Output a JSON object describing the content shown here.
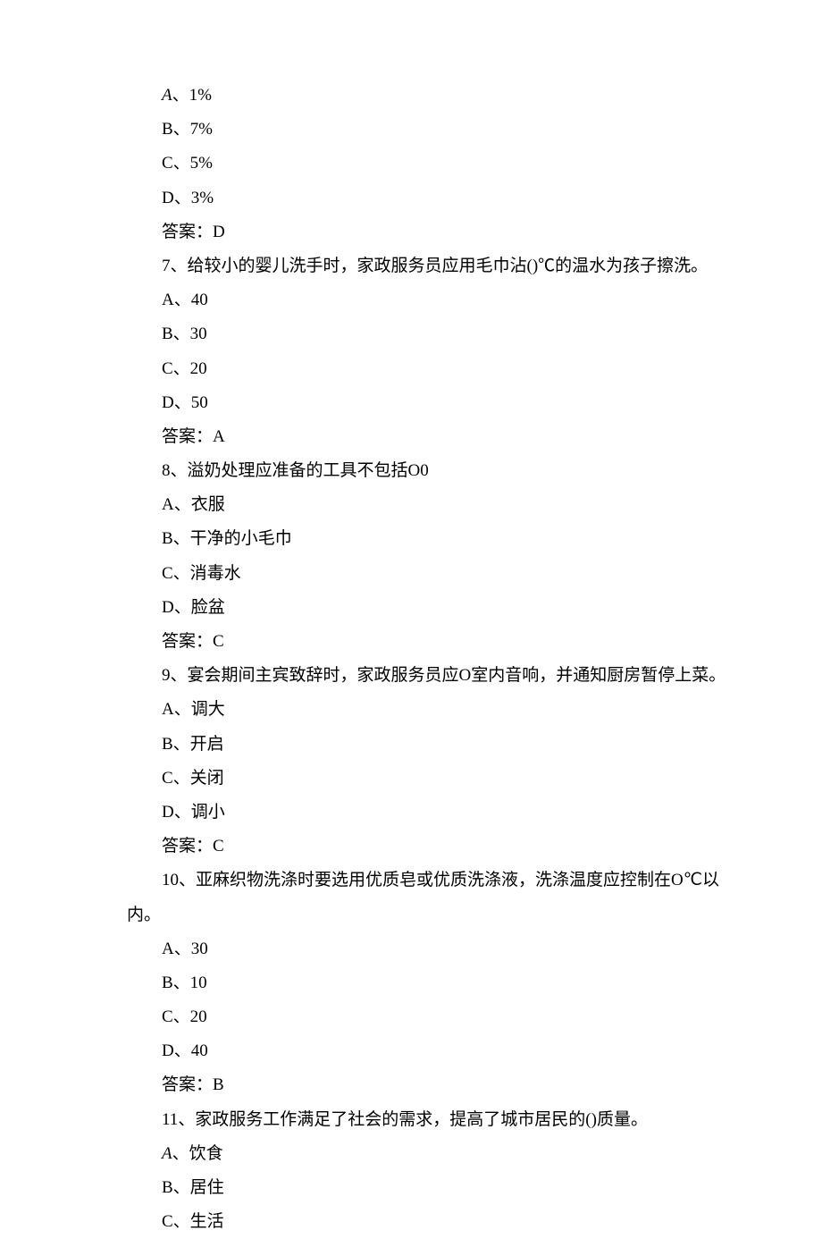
{
  "q6_tail": {
    "optA_letter": "A",
    "optA": "、1%",
    "optB": "B、7%",
    "optC": "C、5%",
    "optD": "D、3%",
    "ans": "答案：D"
  },
  "q7": {
    "stem": "7、给较小的婴儿洗手时，家政服务员应用毛巾沾()℃的温水为孩子擦洗。",
    "optA": "A、40",
    "optB": "B、30",
    "optC": "C、20",
    "optD": "D、50",
    "ans": "答案：A"
  },
  "q8": {
    "stem": "8、溢奶处理应准备的工具不包括O0",
    "optA": "A、衣服",
    "optB": "B、干净的小毛巾",
    "optC": "C、消毒水",
    "optD": "D、脸盆",
    "ans": "答案：C"
  },
  "q9": {
    "stem": "9、宴会期间主宾致辞时，家政服务员应O室内音响，并通知厨房暂停上菜。",
    "optA": "A、调大",
    "optB": "B、开启",
    "optC": "C、关闭",
    "optD": "D、调小",
    "ans": "答案：C"
  },
  "q10": {
    "stem_l1": "10、亚麻织物洗涤时要选用优质皂或优质洗涤液，洗涤温度应控制在O℃以",
    "stem_l2": "内。",
    "optA": "A、30",
    "optB": "B、10",
    "optC": "C、20",
    "optD": "D、40",
    "ans": "答案：B"
  },
  "q11": {
    "stem": "11、家政服务工作满足了社会的需求，提高了城市居民的()质量。",
    "optA_letter": "A",
    "optA": "、饮食",
    "optB": "B、居住",
    "optC": "C、生活"
  }
}
